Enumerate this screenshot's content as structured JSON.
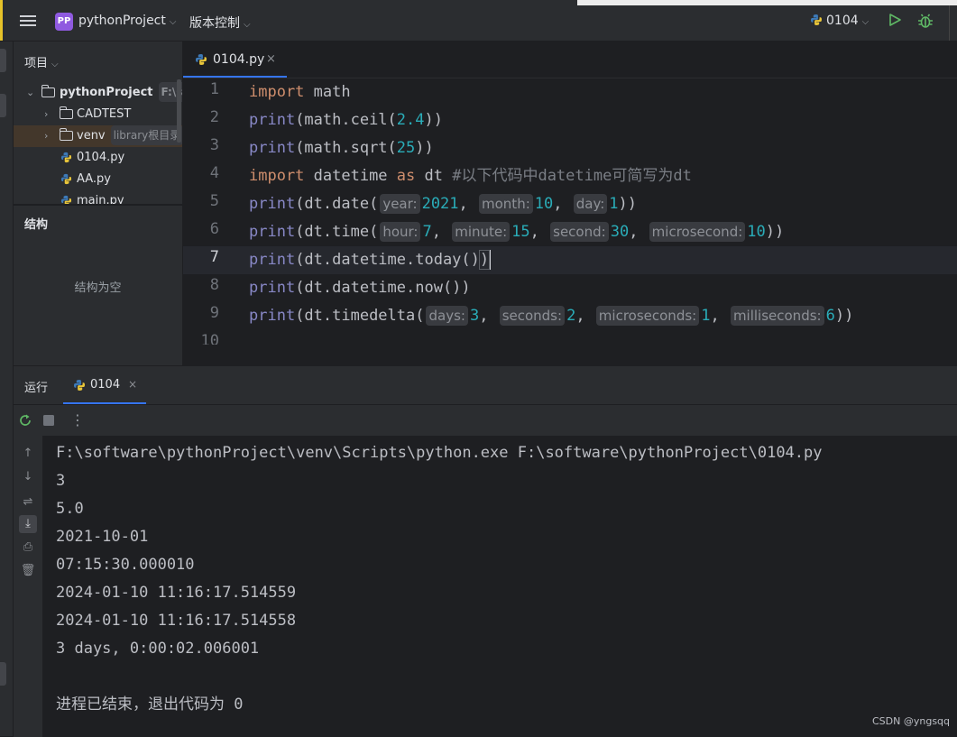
{
  "titlebar": {
    "project_badge": "PP",
    "project_name": "pythonProject",
    "vcs_label": "版本控制",
    "run_config": "0104"
  },
  "project_panel": {
    "header": "项目",
    "tree": [
      {
        "name": "pythonProject",
        "hint": "F:\\soft",
        "type": "folder-root",
        "expanded": true
      },
      {
        "name": "CADTEST",
        "hint": "",
        "type": "folder",
        "expanded": false
      },
      {
        "name": "venv",
        "hint": "library根目录",
        "type": "folder",
        "expanded": false,
        "selected": true
      },
      {
        "name": "0104.py",
        "hint": "",
        "type": "py"
      },
      {
        "name": "AA.py",
        "hint": "",
        "type": "py"
      },
      {
        "name": "main.py",
        "hint": "",
        "type": "py"
      }
    ]
  },
  "structure_panel": {
    "title": "结构",
    "empty_text": "结构为空"
  },
  "editor": {
    "tab_name": "0104.py",
    "tab_close": "×",
    "active_line": 7,
    "line_numbers": [
      "1",
      "2",
      "3",
      "4",
      "5",
      "6",
      "7",
      "8",
      "9",
      "10"
    ],
    "lines": [
      [
        {
          "t": "import",
          "c": "kw"
        },
        {
          "t": " math"
        }
      ],
      [
        {
          "t": "print",
          "c": "bi"
        },
        {
          "t": "(math.ceil("
        },
        {
          "t": "2.4",
          "c": "num"
        },
        {
          "t": "))"
        }
      ],
      [
        {
          "t": "print",
          "c": "bi"
        },
        {
          "t": "(math.sqrt("
        },
        {
          "t": "25",
          "c": "num"
        },
        {
          "t": "))"
        }
      ],
      [
        {
          "t": "import",
          "c": "kw"
        },
        {
          "t": " datetime "
        },
        {
          "t": "as",
          "c": "kw"
        },
        {
          "t": " dt "
        },
        {
          "t": "#以下代码中datetime可简写为dt",
          "c": "cm"
        }
      ],
      [
        {
          "t": "print",
          "c": "bi"
        },
        {
          "t": "(dt.date("
        },
        {
          "h": "year:"
        },
        {
          "t": "2021",
          "c": "num"
        },
        {
          "t": ", "
        },
        {
          "h": "month:"
        },
        {
          "t": "10",
          "c": "num"
        },
        {
          "t": ", "
        },
        {
          "h": "day:"
        },
        {
          "t": "1",
          "c": "num"
        },
        {
          "t": "))"
        }
      ],
      [
        {
          "t": "print",
          "c": "bi"
        },
        {
          "t": "(dt.time("
        },
        {
          "h": "hour:"
        },
        {
          "t": "7",
          "c": "num"
        },
        {
          "t": ", "
        },
        {
          "h": "minute:"
        },
        {
          "t": "15",
          "c": "num"
        },
        {
          "t": ", "
        },
        {
          "h": "second:"
        },
        {
          "t": "30",
          "c": "num"
        },
        {
          "t": ", "
        },
        {
          "h": "microsecond:"
        },
        {
          "t": "10",
          "c": "num"
        },
        {
          "t": "))"
        }
      ],
      [
        {
          "t": "print",
          "c": "bi"
        },
        {
          "t": "(dt.datetime.today()"
        },
        {
          "t": ")",
          "c": "bm"
        },
        {
          "caret": true
        }
      ],
      [
        {
          "t": "print",
          "c": "bi"
        },
        {
          "t": "(dt.datetime.now())"
        }
      ],
      [
        {
          "t": "print",
          "c": "bi"
        },
        {
          "t": "(dt.timedelta("
        },
        {
          "h": "days:"
        },
        {
          "t": "3",
          "c": "num"
        },
        {
          "t": ", "
        },
        {
          "h": "seconds:"
        },
        {
          "t": "2",
          "c": "num"
        },
        {
          "t": ", "
        },
        {
          "h": "microseconds:"
        },
        {
          "t": "1",
          "c": "num"
        },
        {
          "t": ", "
        },
        {
          "h": "milliseconds:"
        },
        {
          "t": "6",
          "c": "num"
        },
        {
          "t": "))"
        }
      ],
      []
    ]
  },
  "run_panel": {
    "title": "运行",
    "tab_name": "0104",
    "tab_close": "×",
    "console_lines": [
      "F:\\software\\pythonProject\\venv\\Scripts\\python.exe F:\\software\\pythonProject\\0104.py",
      "3",
      "5.0",
      "2021-10-01",
      "07:15:30.000010",
      "2024-01-10 11:16:17.514559",
      "2024-01-10 11:16:17.514558",
      "3 days, 0:00:02.006001",
      "",
      "进程已结束，退出代码为 0"
    ],
    "watermark": "CSDN @yngsqq"
  },
  "colors": {
    "accent": "#3574f0",
    "run_green": "#5fb865",
    "project_badge": "#8f5ae0"
  }
}
